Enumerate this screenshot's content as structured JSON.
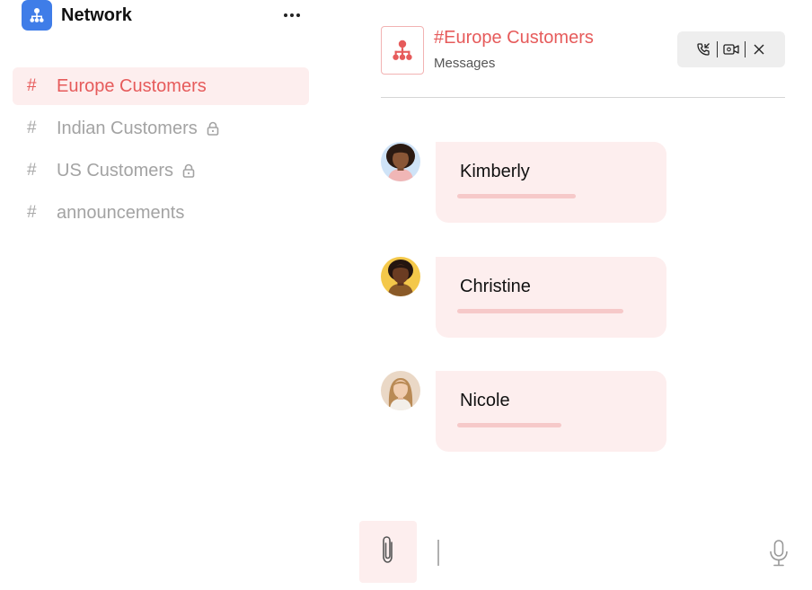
{
  "app": {
    "title": "Network",
    "logo_icon": "org-chart-icon",
    "accent": "#3f7de8"
  },
  "sidebar": {
    "channels": [
      {
        "hash": "#",
        "label": "Europe Customers",
        "locked": false,
        "active": true
      },
      {
        "hash": "#",
        "label": "Indian Customers",
        "locked": true,
        "active": false
      },
      {
        "hash": "#",
        "label": "US Customers",
        "locked": true,
        "active": false
      },
      {
        "hash": "#",
        "label": "announcements",
        "locked": false,
        "active": false
      }
    ]
  },
  "channel_header": {
    "title": "#Europe Customers",
    "subtitle": "Messages",
    "icon": "org-chart-icon",
    "actions": [
      "phone-call-icon",
      "video-call-icon",
      "close-icon"
    ]
  },
  "messages": [
    {
      "sender": "Kimberly",
      "text_fill": 0.63
    },
    {
      "sender": "Christine",
      "text_fill": 0.88
    },
    {
      "sender": "Nicole",
      "text_fill": 0.55
    }
  ],
  "composer": {
    "attach_icon": "paperclip-icon",
    "mic_icon": "microphone-icon"
  },
  "colors": {
    "accent_red": "#e65b5b",
    "bubble_bg": "#fdeeee",
    "active_bg": "#fdeeee"
  }
}
